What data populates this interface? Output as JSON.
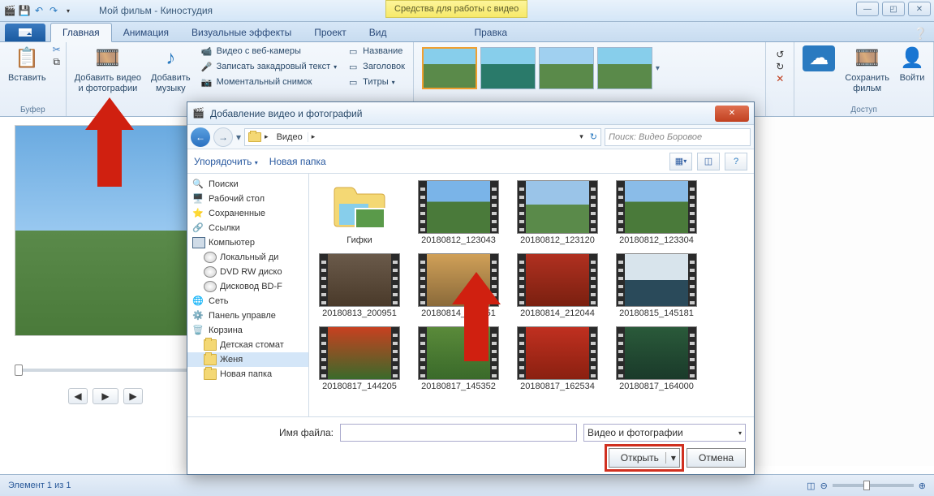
{
  "titlebar": {
    "title": "Мой фильм - Киностудия",
    "contextual": "Средства для работы с видео"
  },
  "sysbtns": {
    "min": "—",
    "max": "◰",
    "close": "✕"
  },
  "ribbon": {
    "tabs": [
      "Главная",
      "Анимация",
      "Визуальные эффекты",
      "Проект",
      "Вид",
      "Правка"
    ],
    "active": 0,
    "groups": {
      "buffer": {
        "label": "Буфер",
        "paste": "Вставить"
      },
      "add": {
        "addvideo": "Добавить видео\nи фотографии",
        "addmusic": "Добавить\nмузыку"
      },
      "items": {
        "webcam": "Видео с веб-камеры",
        "voiceover": "Записать закадровый текст",
        "snapshot": "Моментальный снимок"
      },
      "labels": {
        "name": "Название",
        "header": "Заголовок",
        "titles": "Титры"
      },
      "share": {
        "label": "Доступ",
        "save": "Сохранить\nфильм",
        "signin": "Войти"
      }
    }
  },
  "status": {
    "text": "Элемент 1 из 1"
  },
  "dialog": {
    "title": "Добавление видео и фотографий",
    "breadcrumb": [
      "Видео"
    ],
    "search_placeholder": "Поиск: Видео Боровое",
    "organize": "Упорядочить",
    "newfolder": "Новая папка",
    "tree": [
      "Поиски",
      "Рабочий стол",
      "Сохраненные",
      "Ссылки",
      "Компьютер",
      "Локальный ди",
      "DVD RW диско",
      "Дисковод BD-F",
      "Сеть",
      "Панель управле",
      "Корзина",
      "Детская стомат",
      "Женя",
      "Новая папка"
    ],
    "tree_selected": 12,
    "files": [
      {
        "label": "Гифки",
        "type": "folder"
      },
      {
        "label": "20180812_123043",
        "type": "video",
        "bg": "linear-gradient(#7ab4e8 40%,#4a7a3a 40%)"
      },
      {
        "label": "20180812_123120",
        "type": "video",
        "bg": "linear-gradient(#9ac4e8 45%,#5a8a4a 45%)"
      },
      {
        "label": "20180812_123304",
        "type": "video",
        "bg": "linear-gradient(#8abce8 40%,#4a7a3a 40%)"
      },
      {
        "label": "20180813_200951",
        "type": "video",
        "bg": "linear-gradient(#6a5a4a,#4a3a2a)"
      },
      {
        "label": "20180814_203551",
        "type": "video",
        "bg": "linear-gradient(#d0a058,#8a6a3a)"
      },
      {
        "label": "20180814_212044",
        "type": "video",
        "bg": "linear-gradient(#b03020,#7a2010)"
      },
      {
        "label": "20180815_145181",
        "type": "video",
        "bg": "linear-gradient(#d8e4ec 50%,#2a4a5a 50%)"
      },
      {
        "label": "20180817_144205",
        "type": "video",
        "bg": "linear-gradient(#c84020,#3a6a2a)"
      },
      {
        "label": "20180817_145352",
        "type": "video",
        "bg": "linear-gradient(#5a8a3a,#3a6a2a)"
      },
      {
        "label": "20180817_162534",
        "type": "video",
        "bg": "linear-gradient(#c03020,#8a2010)"
      },
      {
        "label": "20180817_164000",
        "type": "video",
        "bg": "linear-gradient(#2a5a3a,#1a3a2a)"
      }
    ],
    "filename_label": "Имя файла:",
    "filter": "Видео и фотографии",
    "open": "Открыть",
    "cancel": "Отмена"
  }
}
